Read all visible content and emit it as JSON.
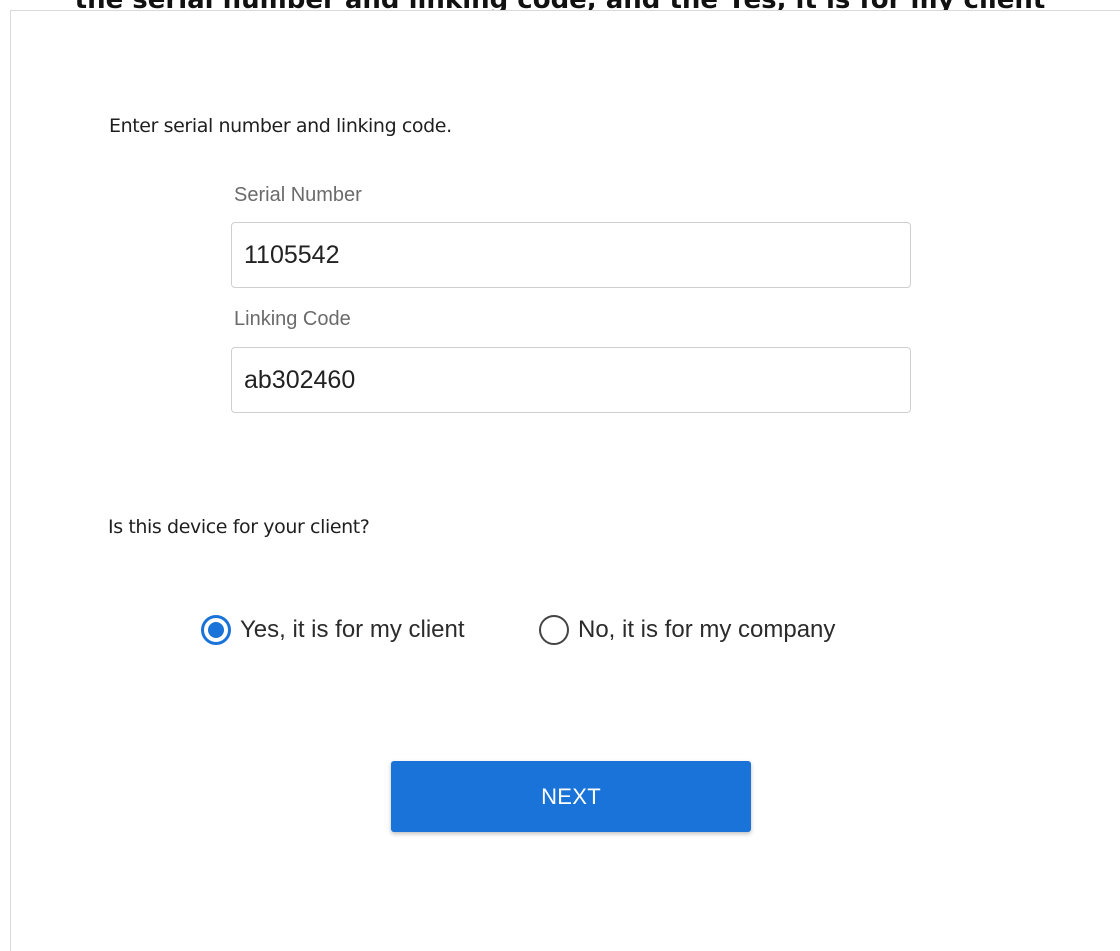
{
  "header": {
    "caption": "the serial number and linking code, and the Yes, it is for my client"
  },
  "form": {
    "instruction": "Enter serial number and linking code.",
    "serial_number": {
      "label": "Serial Number",
      "value": "1105542"
    },
    "linking_code": {
      "label": "Linking Code",
      "value": "ab302460"
    },
    "question": "Is this device for your client?",
    "options": [
      {
        "label": "Yes, it is for my client",
        "selected": true
      },
      {
        "label": "No, it is for my company",
        "selected": false
      }
    ],
    "next_label": "NEXT"
  },
  "colors": {
    "accent": "#1a73d8",
    "label_gray": "#6b6b6b",
    "border": "#cfcfcf"
  },
  "icons": {
    "selected_radio": "radio-checked-icon",
    "unselected_radio": "radio-unchecked-icon"
  }
}
